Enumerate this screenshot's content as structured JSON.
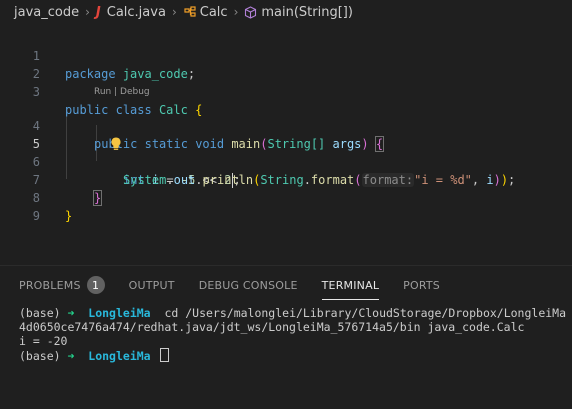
{
  "breadcrumb": {
    "folder": "java_code",
    "file": "Calc.java",
    "class": "Calc",
    "method": "main(String[])"
  },
  "editor": {
    "codelens": "Run | Debug",
    "lines": [
      {
        "n": "1"
      },
      {
        "n": "2"
      },
      {
        "n": "3"
      },
      {
        "n": "4"
      },
      {
        "n": "5"
      },
      {
        "n": "6"
      },
      {
        "n": "7"
      },
      {
        "n": "8"
      },
      {
        "n": "9"
      }
    ],
    "tokens": {
      "package_kw": "package",
      "package_name": "java_code",
      "semi": ";",
      "public": "public",
      "class": "class",
      "class_name": "Calc",
      "lbrace": "{",
      "rbrace": "}",
      "static": "static",
      "void": "void",
      "main": "main",
      "lparen": "(",
      "rparen": ")",
      "string_arr": "String[]",
      "args": "args",
      "int": "int",
      "i": "i",
      "assign": "=",
      "neg5": "-5",
      "shift": "<<",
      "two": "2",
      "system": "System",
      "dot": ".",
      "out": "out",
      "println": "println",
      "string_cls": "String",
      "format": "format",
      "hint": "format:",
      "fmt_str": "\"i = %d\"",
      "comma": ",",
      "i_arg": " i"
    }
  },
  "panel": {
    "tabs": [
      {
        "label": "PROBLEMS",
        "badge": "1"
      },
      {
        "label": "OUTPUT"
      },
      {
        "label": "DEBUG CONSOLE"
      },
      {
        "label": "TERMINAL"
      },
      {
        "label": "PORTS"
      }
    ],
    "active_tab": "TERMINAL",
    "terminal": {
      "prompt_env": "(base)",
      "prompt_arrow": "➜",
      "user": "LongleiMa",
      "command_1": "cd /Users/malonglei/Library/CloudStorage/Dropbox/LongleiMa",
      "command_2": "4d0650ce7476a474/redhat.java/jdt_ws/LongleiMa_576714a5/bin java_code.Calc",
      "output": "i = -20"
    }
  },
  "colors": {
    "background": "#1f1f1f",
    "keyword": "#569cd6",
    "type": "#4ec9b0",
    "function": "#dcdcaa",
    "variable": "#9cdcfe",
    "number": "#b5cea8",
    "string": "#ce9178",
    "error_icon": "#e2453c",
    "bulb": "#f5c542"
  }
}
